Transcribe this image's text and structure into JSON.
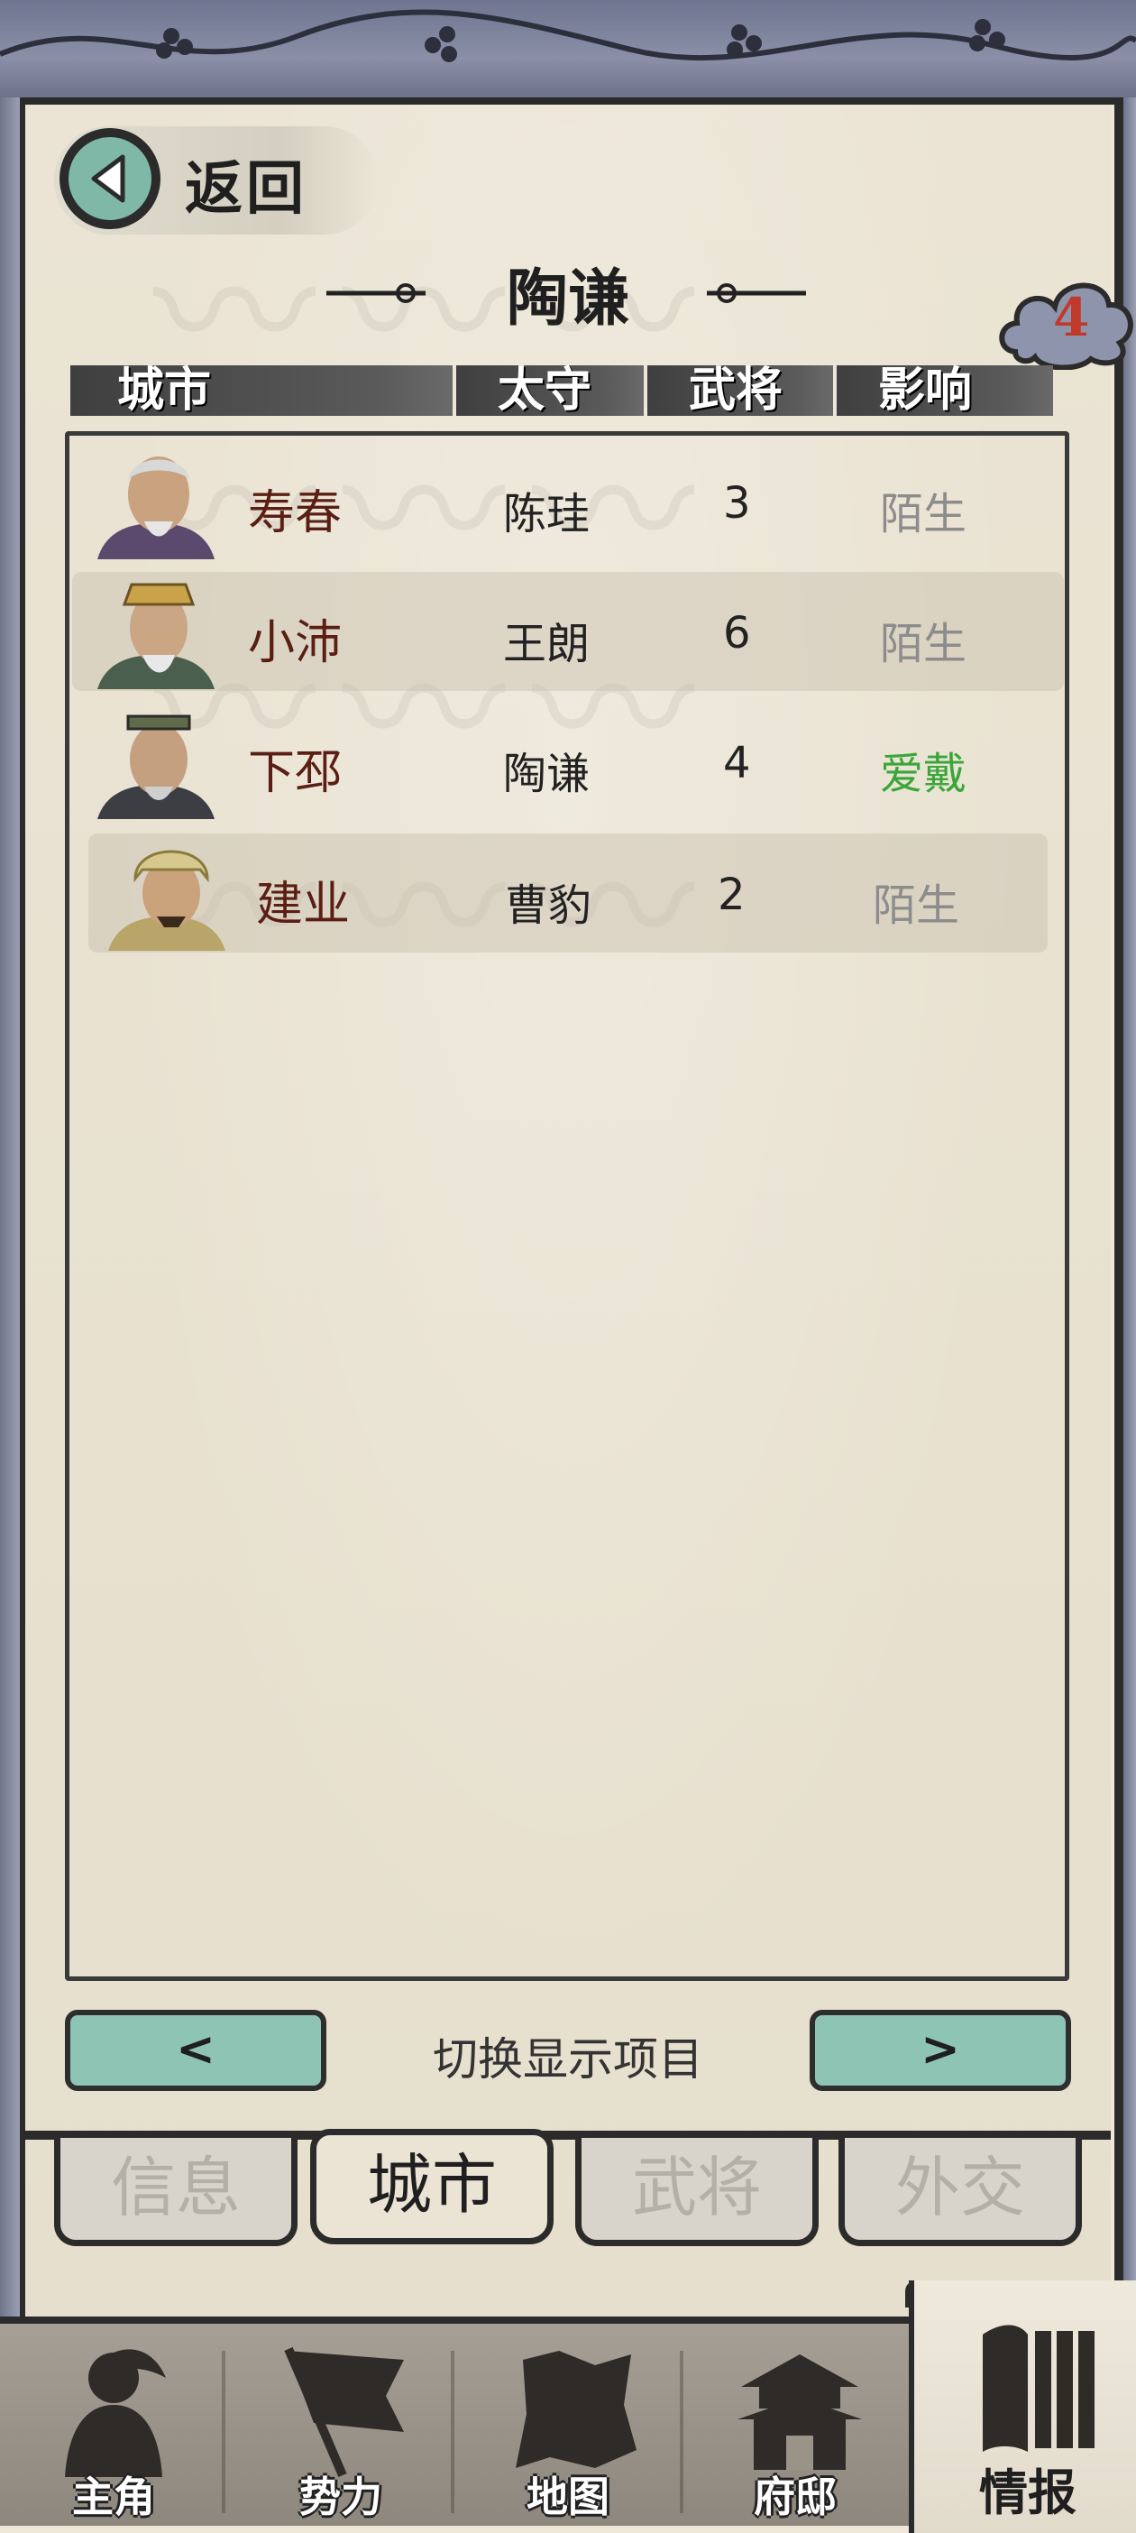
{
  "header": {
    "back_label": "返回",
    "faction_title": "陶谦",
    "badge_count": "4"
  },
  "columns": [
    "城市",
    "太守",
    "武将",
    "影响"
  ],
  "rows": [
    {
      "city": "寿春",
      "governor": "陈珪",
      "generals": "3",
      "influence": "陌生",
      "influence_color": "#8c8c8c"
    },
    {
      "city": "小沛",
      "governor": "王朗",
      "generals": "6",
      "influence": "陌生",
      "influence_color": "#8c8c8c"
    },
    {
      "city": "下邳",
      "governor": "陶谦",
      "generals": "4",
      "influence": "爱戴",
      "influence_color": "#3aa63a"
    },
    {
      "city": "建业",
      "governor": "曹豹",
      "generals": "2",
      "influence": "陌生",
      "influence_color": "#8c8c8c"
    }
  ],
  "switch": {
    "prev_label": "<",
    "label": "切换显示项目",
    "next_label": ">"
  },
  "tabs": [
    {
      "label": "信息",
      "active": false
    },
    {
      "label": "城市",
      "active": true
    },
    {
      "label": "武将",
      "active": false
    },
    {
      "label": "外交",
      "active": false
    }
  ],
  "bottom_nav": [
    {
      "label": "主角",
      "icon": "warrior-icon",
      "active": false
    },
    {
      "label": "势力",
      "icon": "flag-icon",
      "active": false
    },
    {
      "label": "地图",
      "icon": "map-icon",
      "active": false
    },
    {
      "label": "府邸",
      "icon": "mansion-icon",
      "active": false
    },
    {
      "label": "情报",
      "icon": "scroll-icon",
      "active": true
    }
  ]
}
